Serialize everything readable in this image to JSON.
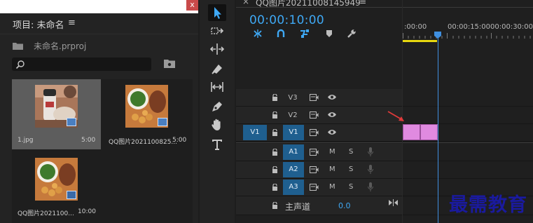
{
  "project": {
    "title": "项目: 未命名",
    "menu": "≡",
    "close": "x",
    "file": "未命名.prproj",
    "items": [
      {
        "name": "1.jpg",
        "duration": "5:00"
      },
      {
        "name": "QQ图片2021100825...",
        "duration": "5:00"
      },
      {
        "name": "QQ图片2021100...",
        "duration": "10:00"
      }
    ]
  },
  "timeline": {
    "sequence_name": "QQ图片20211008145949",
    "tab_close": "×",
    "menu": "≡",
    "timecode": "00:00:10:00",
    "ruler": [
      ":00:00",
      "00:00:15:00",
      "00:00:30:00"
    ],
    "tracks": [
      {
        "name": "V3",
        "source": ""
      },
      {
        "name": "V2",
        "source": ""
      },
      {
        "name": "V1",
        "source": "V1"
      },
      {
        "name": "A1",
        "source": ""
      },
      {
        "name": "A2",
        "source": ""
      },
      {
        "name": "A3",
        "source": ""
      }
    ],
    "mute_label": "M",
    "solo_label": "S",
    "master_label": "主声道",
    "master_value": "0.0"
  },
  "watermark": "最需教育",
  "colors": {
    "accent": "#3fa9f5",
    "clip": "#e08ae0",
    "track_patch": "#1f5f8f",
    "workarea": "#e8d80f",
    "close": "#c94a4a"
  }
}
